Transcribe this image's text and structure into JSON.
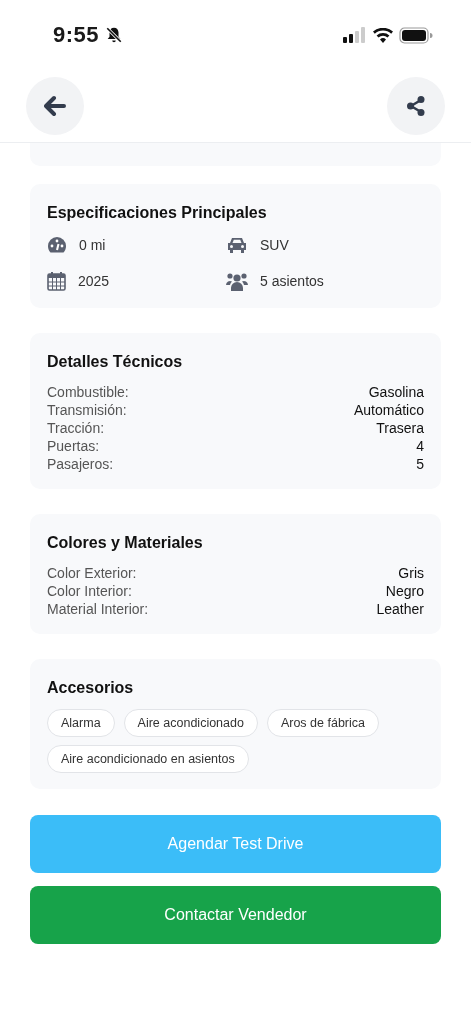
{
  "status_bar": {
    "time": "9:55"
  },
  "specs": {
    "title": "Especificaciones Principales",
    "items": [
      {
        "kind": "mileage",
        "text": "0 mi"
      },
      {
        "kind": "body",
        "text": "SUV"
      },
      {
        "kind": "year",
        "text": "2025"
      },
      {
        "kind": "seats",
        "text": "5 asientos"
      }
    ]
  },
  "details": {
    "title": "Detalles Técnicos",
    "rows": [
      {
        "label": "Combustible:",
        "value": "Gasolina"
      },
      {
        "label": "Transmisión:",
        "value": "Automático"
      },
      {
        "label": "Tracción:",
        "value": "Trasera"
      },
      {
        "label": "Puertas:",
        "value": "4"
      },
      {
        "label": "Pasajeros:",
        "value": "5"
      }
    ]
  },
  "colors": {
    "title": "Colores y Materiales",
    "rows": [
      {
        "label": "Color Exterior:",
        "value": "Gris"
      },
      {
        "label": "Color Interior:",
        "value": "Negro"
      },
      {
        "label": "Material Interior:",
        "value": "Leather"
      }
    ]
  },
  "accessories": {
    "title": "Accesorios",
    "tags": [
      "Alarma",
      "Aire acondicionado",
      "Aros de fábrica",
      "Aire acondicionado en asientos"
    ]
  },
  "buttons": [
    {
      "kind": "secondary",
      "label": "Agendar Test Drive"
    },
    {
      "kind": "primary",
      "label": "Contactar Vendedor"
    }
  ]
}
